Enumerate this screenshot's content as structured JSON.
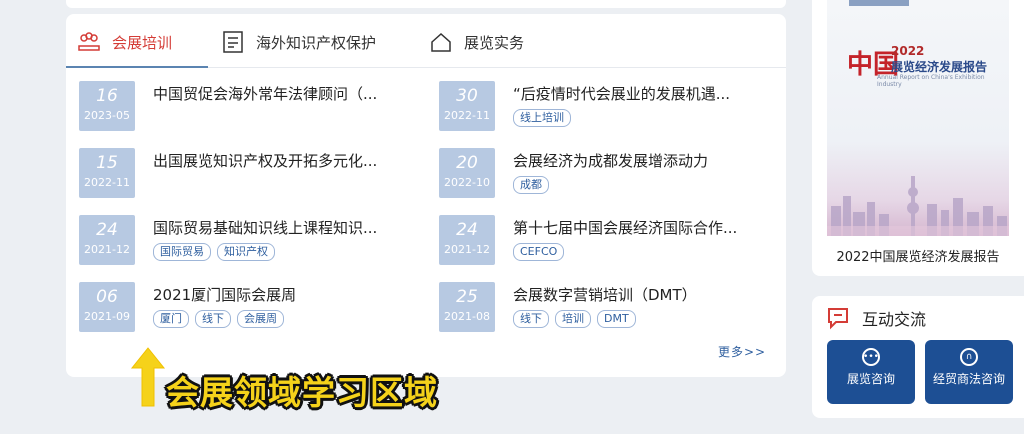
{
  "tabs": [
    {
      "label": "会展培训",
      "icon": "people-icon",
      "active": true
    },
    {
      "label": "海外知识产权保护",
      "icon": "document-icon",
      "active": false
    },
    {
      "label": "展览实务",
      "icon": "home-icon",
      "active": false
    }
  ],
  "items": [
    {
      "day": "16",
      "ym": "2023-05",
      "title": "中国贸促会海外常年法律顾问（...",
      "tags": []
    },
    {
      "day": "30",
      "ym": "2022-11",
      "title": "“后疫情时代会展业的发展机遇...",
      "tags": [
        "线上培训"
      ]
    },
    {
      "day": "15",
      "ym": "2022-11",
      "title": "出国展览知识产权及开拓多元化...",
      "tags": []
    },
    {
      "day": "20",
      "ym": "2022-10",
      "title": "会展经济为成都发展增添动力",
      "tags": [
        "成都"
      ]
    },
    {
      "day": "24",
      "ym": "2021-12",
      "title": "国际贸易基础知识线上课程知识...",
      "tags": [
        "国际贸易",
        "知识产权"
      ]
    },
    {
      "day": "24",
      "ym": "2021-12",
      "title": "第十七届中国会展经济国际合作...",
      "tags": [
        "CEFCO"
      ]
    },
    {
      "day": "06",
      "ym": "2021-09",
      "title": "2021厦门国际会展周",
      "tags": [
        "厦门",
        "线下",
        "会展周"
      ]
    },
    {
      "day": "25",
      "ym": "2021-08",
      "title": "会展数字营销培训（DMT）",
      "tags": [
        "线下",
        "培训",
        "DMT"
      ]
    }
  ],
  "more_label": "更多>>",
  "overlay_label": "会展领域学习区域",
  "report": {
    "cn_mark": "中国",
    "year": "2022",
    "title": "展览经济发展报告",
    "en_subtitle": "Annual Report on China's Exhibition Industry",
    "caption": "2022中国展览经济发展报告"
  },
  "interaction": {
    "title": "互动交流",
    "buttons": [
      {
        "label": "展览咨询",
        "icon": "chat-icon"
      },
      {
        "label": "经贸商法咨询",
        "icon": "headset-icon"
      }
    ]
  },
  "colors": {
    "accent_red": "#d43c36",
    "date_bg": "#b7c9e2",
    "button_blue": "#1d4f94",
    "overlay_yellow": "#f5d21a"
  }
}
